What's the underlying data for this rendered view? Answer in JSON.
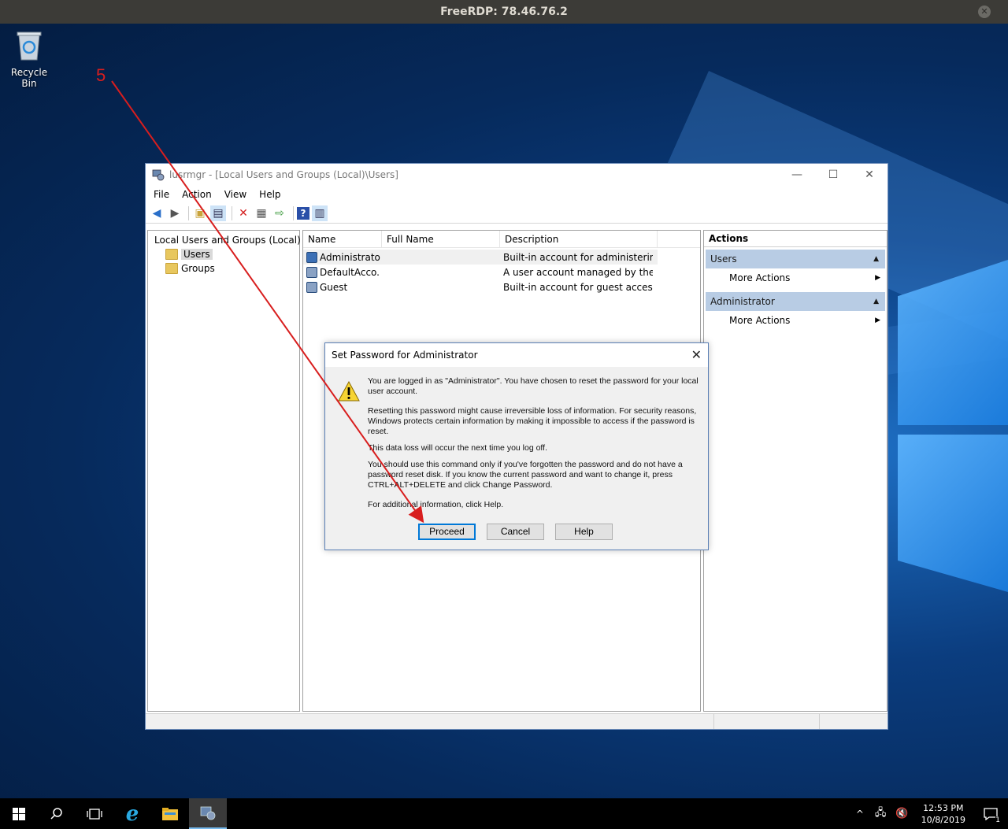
{
  "rdp": {
    "title": "FreeRDP: 78.46.76.2"
  },
  "desktop": {
    "recycle_bin_label": "Recycle Bin"
  },
  "annotation": {
    "step_number": "5"
  },
  "window": {
    "title": "lusrmgr - [Local Users and Groups (Local)\\Users]",
    "menu": [
      "File",
      "Action",
      "View",
      "Help"
    ],
    "tree": {
      "root": "Local Users and Groups (Local)",
      "items": [
        "Users",
        "Groups"
      ]
    },
    "list": {
      "headers": [
        "Name",
        "Full Name",
        "Description"
      ],
      "rows": [
        {
          "name": "Administrator",
          "full_name": "",
          "description": "Built-in account for administering..."
        },
        {
          "name": "DefaultAcco...",
          "full_name": "",
          "description": "A user account managed by the s..."
        },
        {
          "name": "Guest",
          "full_name": "",
          "description": "Built-in account for guest access t..."
        }
      ]
    },
    "actions": {
      "title": "Actions",
      "sections": [
        {
          "label": "Users",
          "item": "More Actions"
        },
        {
          "label": "Administrator",
          "item": "More Actions"
        }
      ]
    }
  },
  "dialog": {
    "title": "Set Password for Administrator",
    "paragraphs": [
      "You are logged in as \"Administrator\". You have chosen to reset the password for your local user account.",
      "Resetting this password might cause irreversible loss of information. For security reasons, Windows protects certain information by making it impossible to access if the password is reset.",
      "This data loss will occur the next time you log off.",
      "You should use this command only if you've forgotten the password and do not have a password reset disk. If you know the current password and want to change it, press CTRL+ALT+DELETE and click Change Password.",
      "For additional information, click Help."
    ],
    "buttons": {
      "proceed": "Proceed",
      "cancel": "Cancel",
      "help": "Help"
    }
  },
  "taskbar": {
    "time": "12:53 PM",
    "date": "10/8/2019",
    "notification_count": "1"
  },
  "colors": {
    "annotation": "#d81e1e",
    "section_bg": "#b8cce4",
    "accent": "#0078d7"
  }
}
